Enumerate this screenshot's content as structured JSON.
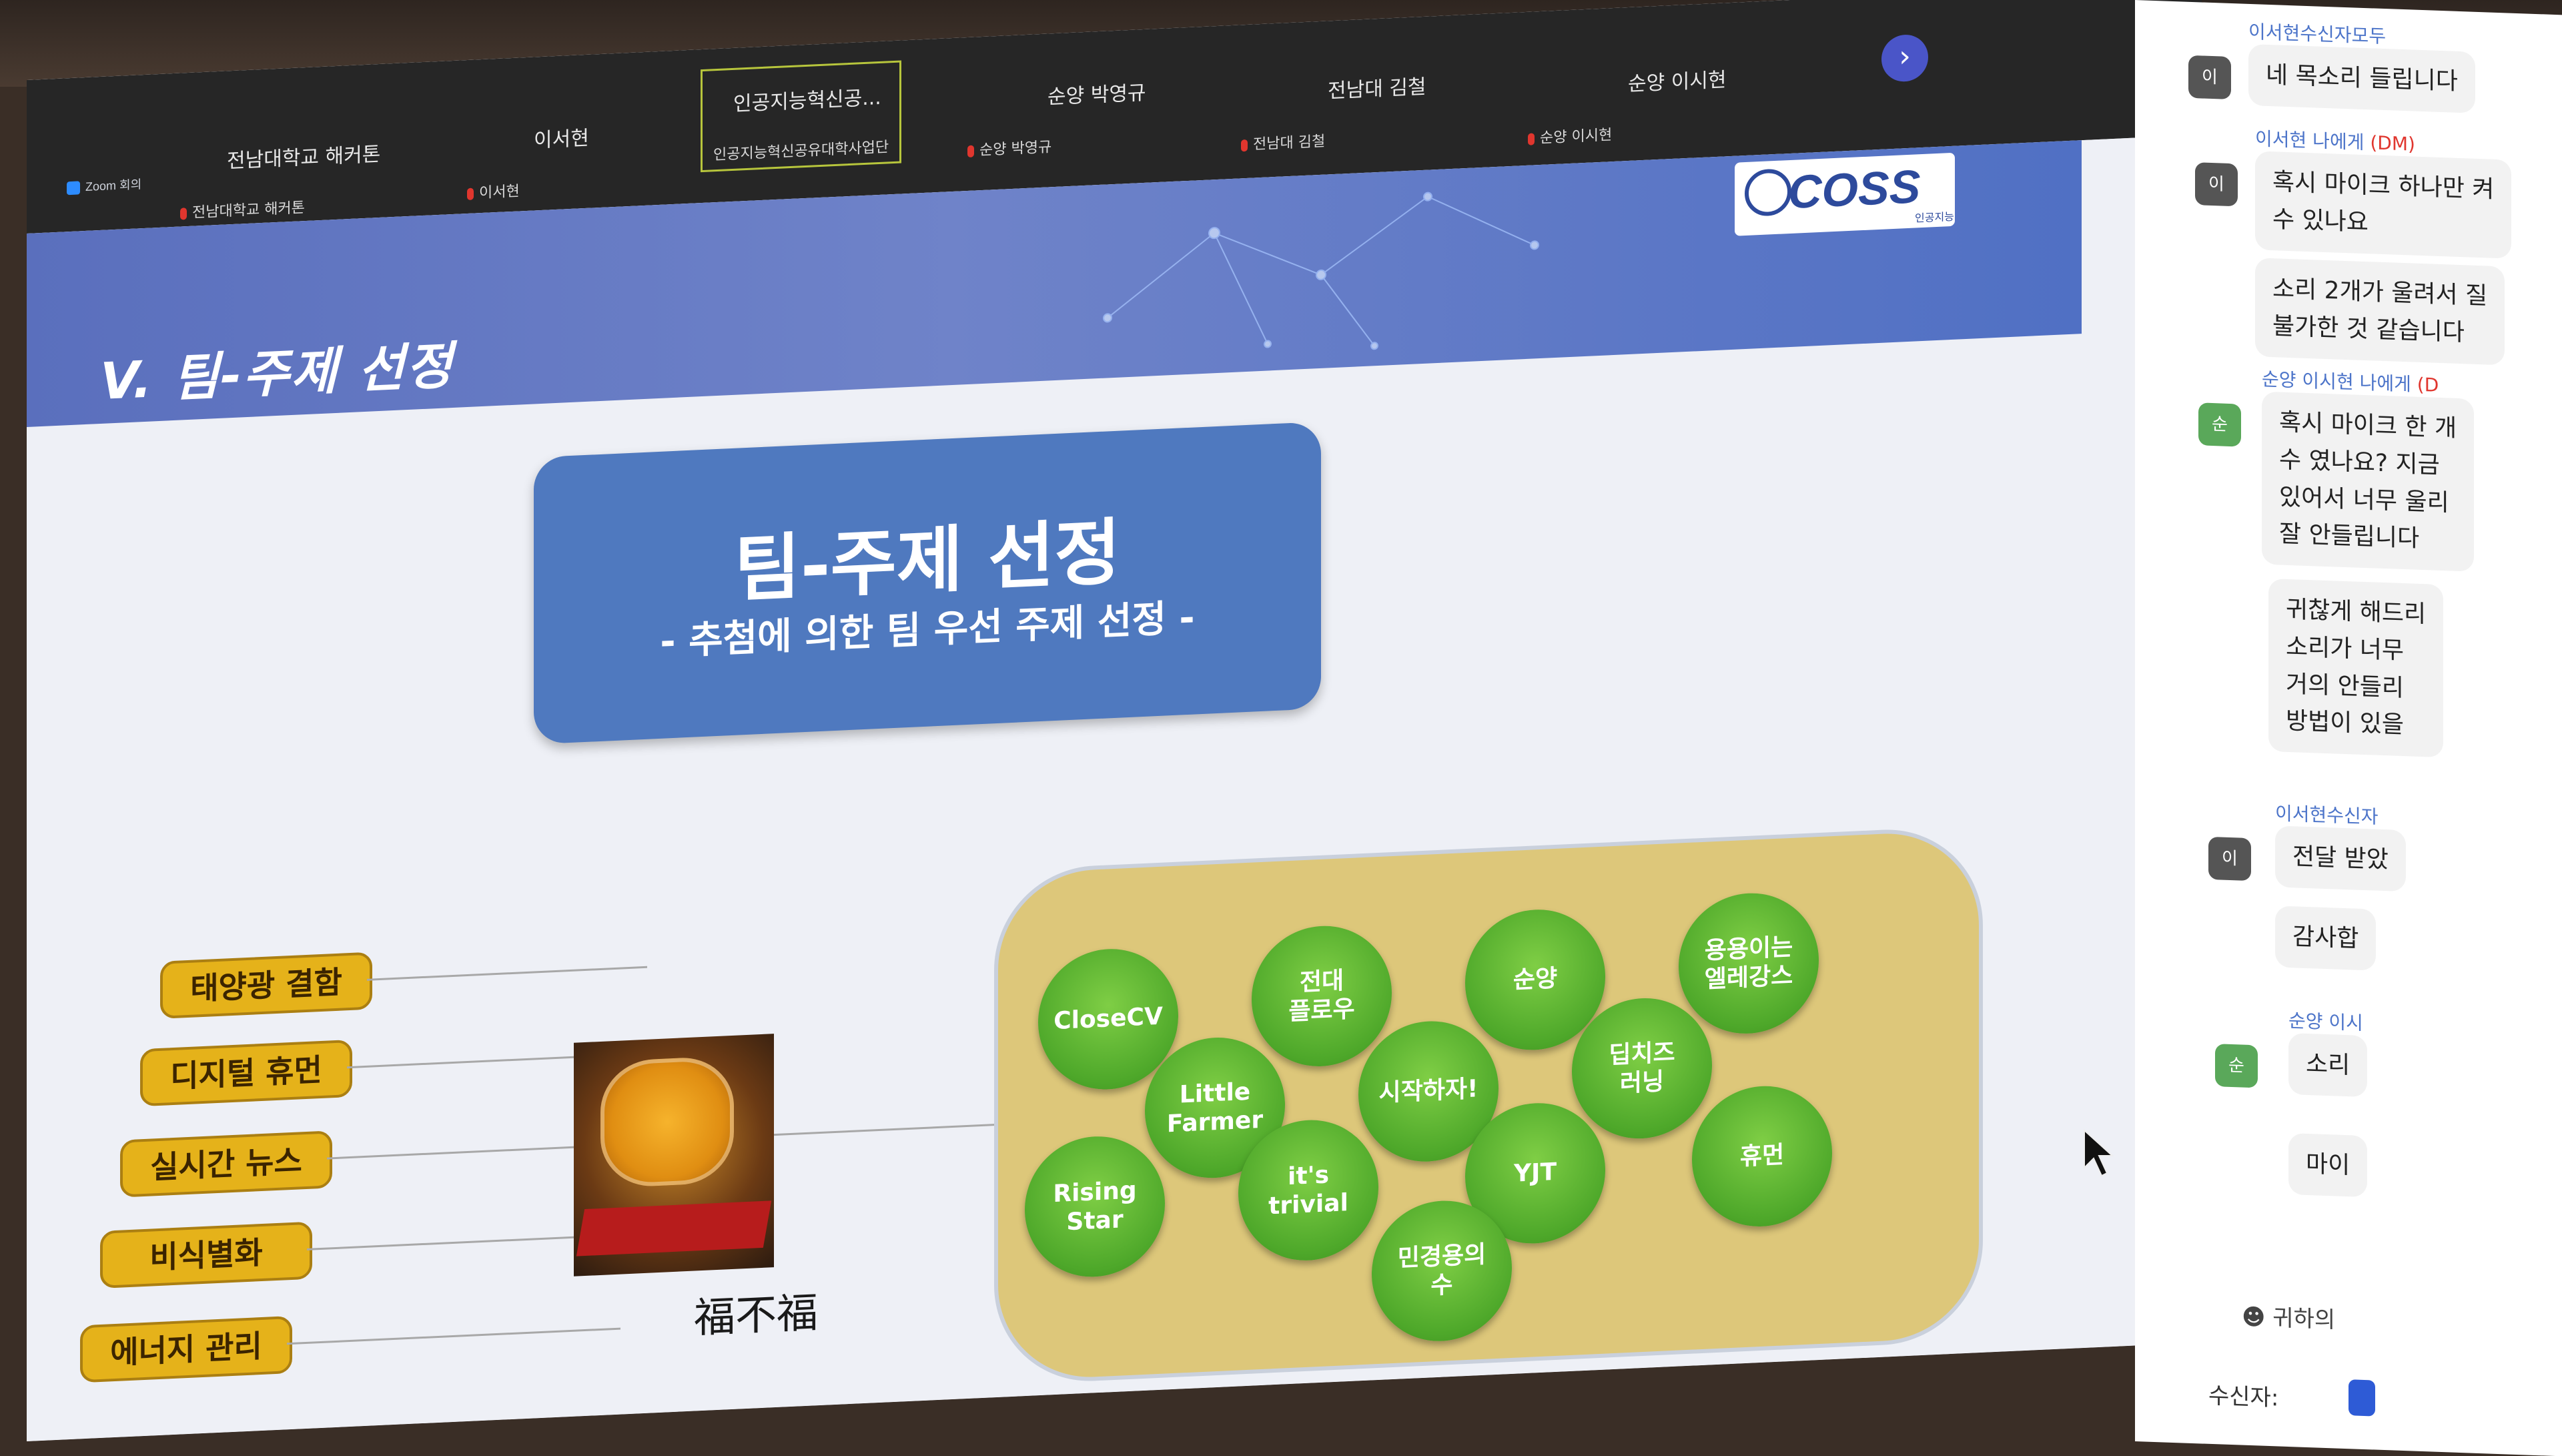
{
  "zoom": {
    "window_title": "Zoom 회의",
    "participants": [
      {
        "name": "전남대학교 해커톤",
        "sub": "전남대학교 해커톤"
      },
      {
        "name": "이서현",
        "sub": "이서현"
      },
      {
        "name": "인공지능혁신공...",
        "sub": "인공지능혁신공유대학사업단"
      },
      {
        "name": "순양 박영규",
        "sub": "순양 박영규"
      },
      {
        "name": "전남대 김철",
        "sub": "전남대 김철"
      },
      {
        "name": "순양 이시현",
        "sub": "순양 이시현"
      }
    ],
    "next_icon": "chevron-right-icon"
  },
  "slide": {
    "section_title": "V. 팀-주제 선정",
    "logo": {
      "text": "COSS",
      "sub": "인공지능"
    },
    "main_title": "팀-주제 선정",
    "main_subtitle": "- 추첨에 의한 팀 우선 주제 선정 -",
    "topics": [
      "태양광 결함",
      "디지털 휴먼",
      "실시간 뉴스",
      "비식별화",
      "에너지 관리"
    ],
    "fortune_text": "福不福",
    "teams": [
      "CloseCV",
      "전대\n플로우",
      "순양",
      "용용이는\n엘레강스",
      "Little\nFarmer",
      "시작하자!",
      "딥치즈\n러닝",
      "Rising\nStar",
      "it's\ntrivial",
      "YJT",
      "휴먼",
      "민경용의\n수"
    ],
    "colors": {
      "band": "#5a6fbd",
      "box": "#4f79bf",
      "tag": "#e5b21a",
      "panel": "#ddc77a",
      "team": "#4ea82a"
    }
  },
  "chat": {
    "messages": [
      {
        "header": "이서현수신자모두",
        "dm": "",
        "avatar": "이",
        "text": "네 목소리 들립니다"
      },
      {
        "header": "이서현 나에게",
        "dm": "(DM)",
        "avatar": "이",
        "text": "혹시 마이크 하나만 켜\n수 있나요"
      },
      {
        "header": "",
        "dm": "",
        "avatar": "",
        "text": "소리 2개가 울려서 질\n불가한 것 같습니다"
      },
      {
        "header": "순양 이시현 나에게",
        "dm": "(D",
        "avatar": "순",
        "text": "혹시 마이크 한 개\n수 였나요? 지금\n있어서 너무 울리\n잘 안들립니다"
      },
      {
        "header": "",
        "dm": "",
        "avatar": "",
        "text": "귀찮게 해드리\n소리가 너무\n거의 안들리\n방법이 있을"
      },
      {
        "header": "이서현수신자",
        "dm": "",
        "avatar": "이",
        "text": "전달 받았"
      },
      {
        "header": "",
        "dm": "",
        "avatar": "",
        "text": "감사합"
      },
      {
        "header": "순양 이시",
        "dm": "",
        "avatar": "순",
        "text": "소리"
      },
      {
        "header": "",
        "dm": "",
        "avatar": "",
        "text": "마이"
      }
    ],
    "private_note": "귀하의",
    "recipient_label": "수신자:"
  }
}
